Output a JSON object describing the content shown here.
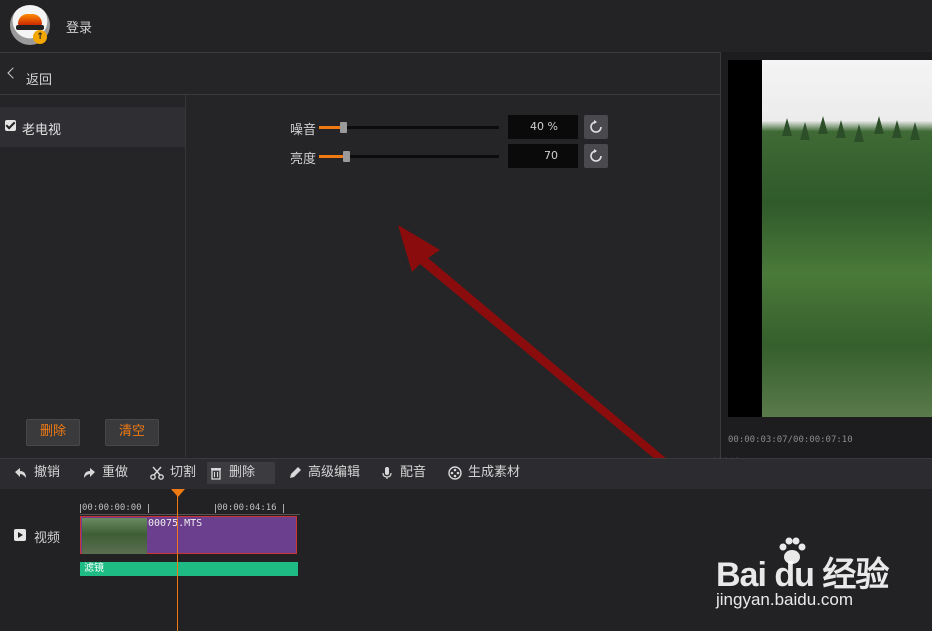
{
  "header": {
    "login_label": "登录"
  },
  "nav": {
    "back_label": "返回"
  },
  "filters": {
    "items": [
      {
        "label": "老电视",
        "checked": true
      }
    ],
    "delete_label": "删除",
    "clear_label": "清空"
  },
  "adjust": {
    "noise": {
      "label": "噪音",
      "value_text": "40 %",
      "level": 0.4
    },
    "brightness": {
      "label": "亮度",
      "value_text": "70",
      "level": 0.7
    }
  },
  "preview": {
    "timecode": "00:00:03:07/00:00:07:10"
  },
  "toolbar": {
    "undo": "撤销",
    "redo": "重做",
    "cut": "切割",
    "delete": "删除",
    "advanced_edit": "高级编辑",
    "dub": "配音",
    "generate": "生成素材"
  },
  "timeline": {
    "track_label": "视频",
    "ruler": [
      "00:00:00:00",
      "00:00:04:16"
    ],
    "clip_name": "00075.MTS",
    "filter_bar": "滤镜"
  },
  "watermark": {
    "logo": "Bai du 经验",
    "url": "jingyan.baidu.com"
  },
  "colors": {
    "accent": "#f07a12",
    "filter_bar": "#1fbb85",
    "clip": "#6b3e8e"
  }
}
